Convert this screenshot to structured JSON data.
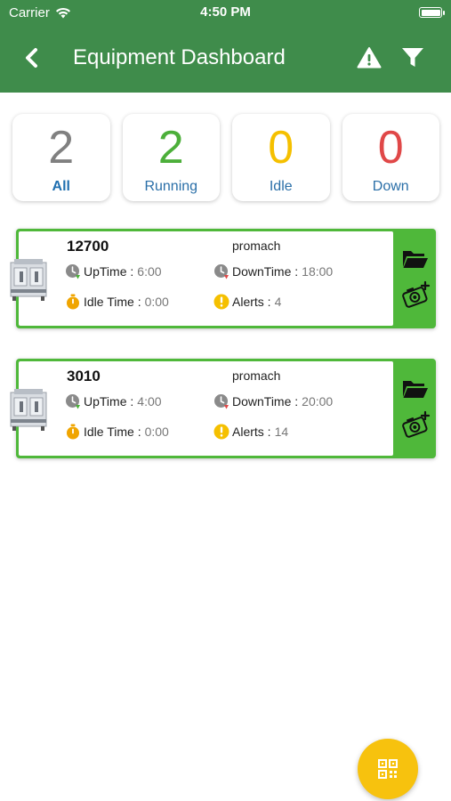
{
  "status_bar": {
    "carrier": "Carrier",
    "time": "4:50 PM"
  },
  "nav": {
    "title": "Equipment Dashboard"
  },
  "summary": [
    {
      "count": "2",
      "label": "All"
    },
    {
      "count": "2",
      "label": "Running"
    },
    {
      "count": "0",
      "label": "Idle"
    },
    {
      "count": "0",
      "label": "Down"
    }
  ],
  "equipment": [
    {
      "id": "12700",
      "brand": "promach",
      "uptime_label": "UpTime :",
      "uptime": "6:00",
      "downtime_label": "DownTime :",
      "downtime": "18:00",
      "idle_label": "Idle Time :",
      "idle": "0:00",
      "alerts_label": "Alerts :",
      "alerts": "4"
    },
    {
      "id": "3010",
      "brand": "promach",
      "uptime_label": "UpTime :",
      "uptime": "4:00",
      "downtime_label": "DownTime :",
      "downtime": "20:00",
      "idle_label": "Idle Time :",
      "idle": "0:00",
      "alerts_label": "Alerts :",
      "alerts": "14"
    }
  ],
  "colors": {
    "header": "#3f8c4b",
    "running": "#4caf3a",
    "idle": "#f5c000",
    "down": "#e04848",
    "label": "#2a6fa8",
    "card_accent": "#4fb83a",
    "fab": "#f7c20e"
  },
  "icons": [
    "wifi-icon",
    "battery-icon",
    "back-chevron-icon",
    "alert-triangle-icon",
    "filter-icon",
    "clock-icon",
    "stopwatch-icon",
    "exclamation-circle-icon",
    "folder-open-icon",
    "camera-add-icon",
    "qr-code-icon"
  ]
}
